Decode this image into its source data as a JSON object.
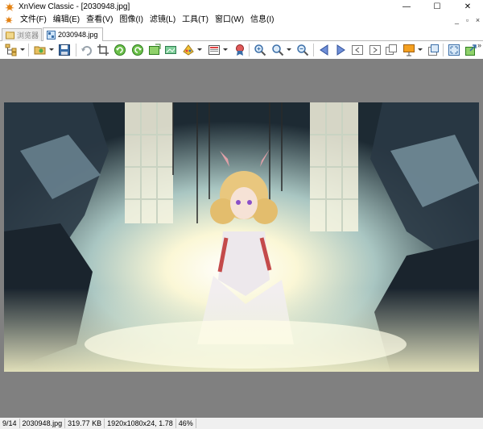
{
  "window": {
    "title": "XnView Classic - [2030948.jpg]",
    "controls": {
      "minimize": "—",
      "maximize": "☐",
      "close": "✕"
    }
  },
  "menu": {
    "items": [
      "文件(F)",
      "编辑(E)",
      "查看(V)",
      "图像(I)",
      "滤镜(L)",
      "工具(T)",
      "窗口(W)",
      "信息(I)"
    ],
    "mdi_controls": [
      "_",
      "▫",
      "×"
    ]
  },
  "tabs": [
    {
      "label": "浏览器",
      "active": false
    },
    {
      "label": "2030948.jpg",
      "active": true
    }
  ],
  "toolbar": {
    "overflow": "»",
    "icons": [
      "browser-tree-icon",
      "open-folder-icon",
      "save-icon",
      "undo-icon",
      "crop-icon",
      "rotate-left-icon",
      "rotate-right-icon",
      "adjust-icon",
      "screen-icon",
      "palette-icon",
      "image-list-icon",
      "badge-icon",
      "zoom-in-icon",
      "zoom-icon",
      "zoom-out-icon",
      "previous-icon",
      "next-icon",
      "first-icon",
      "last-icon",
      "copy-icon",
      "slideshow-icon",
      "page-icon",
      "fullscreen-icon",
      "export-icon"
    ]
  },
  "status": {
    "index": "9/14",
    "filename": "2030948.jpg",
    "filesize": "319.77 KB",
    "dimensions": "1920x1080x24, 1.78",
    "zoom": "46%"
  },
  "colors": {
    "viewer_background": "#808080",
    "statusbar": "#f0f0f0"
  }
}
